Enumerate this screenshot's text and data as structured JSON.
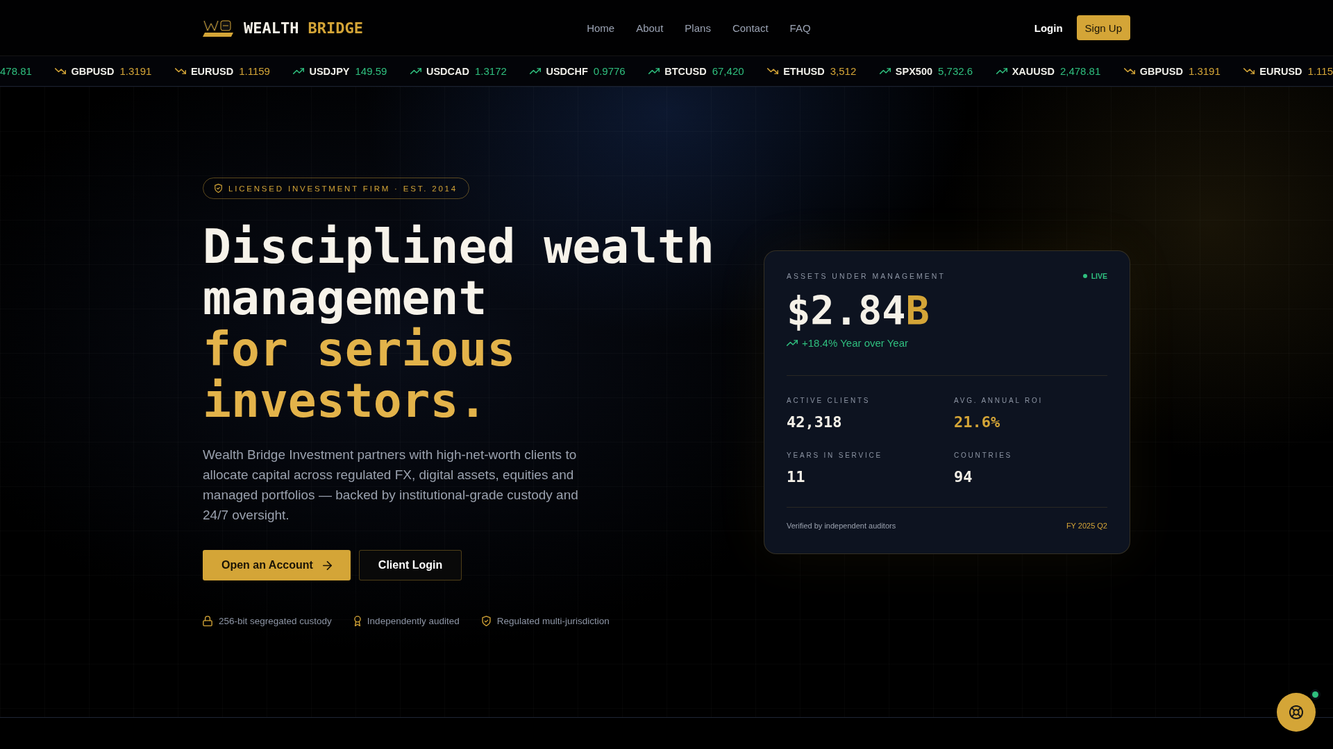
{
  "header": {
    "brand": {
      "name": "WEALTH",
      "accent": "BRIDGE"
    },
    "nav": [
      "Home",
      "About",
      "Plans",
      "Contact",
      "FAQ"
    ],
    "login": "Login",
    "signup": "Sign Up"
  },
  "ticker": [
    {
      "value": "478.81",
      "rising": true
    },
    {
      "symbol": "GBPUSD",
      "value": "1.3191",
      "rising": false
    },
    {
      "symbol": "EURUSD",
      "value": "1.1159",
      "rising": false
    },
    {
      "symbol": "USDJPY",
      "value": "149.59",
      "rising": true
    },
    {
      "symbol": "USDCAD",
      "value": "1.3172",
      "rising": true
    },
    {
      "symbol": "USDCHF",
      "value": "0.9776",
      "rising": true
    },
    {
      "symbol": "BTCUSD",
      "value": "67,420",
      "rising": true
    },
    {
      "symbol": "ETHUSD",
      "value": "3,512",
      "rising": false
    },
    {
      "symbol": "SPX500",
      "value": "5,732.6",
      "rising": true
    },
    {
      "symbol": "XAUUSD",
      "value": "2,478.81",
      "rising": true
    },
    {
      "symbol": "GBPUSD",
      "value": "1.3191",
      "rising": false
    },
    {
      "symbol": "EURUSD",
      "value": "1.115",
      "rising": false
    }
  ],
  "hero": {
    "badge": "LICENSED INVESTMENT FIRM · EST. 2014",
    "headline": "Disciplined wealth management",
    "headline_accent": "for serious investors.",
    "description": "Wealth Bridge Investment partners with high-net-worth clients to allocate capital across regulated FX, digital assets, equities and managed portfolios — backed by institutional-grade custody and 24/7 oversight.",
    "actions": [
      {
        "label": "Open an Account",
        "kind": "primary"
      },
      {
        "label": "Client Login",
        "kind": "secondary"
      }
    ],
    "trust": [
      "256-bit segregated custody",
      "Independently audited",
      "Regulated multi-jurisdiction"
    ]
  },
  "card": {
    "title": "ASSETS UNDER MANAGEMENT",
    "status": {
      "label": "LIVE",
      "live": true
    },
    "value": "$2.84",
    "unit": "B",
    "change": {
      "text": "+18.4% Year over Year",
      "rising": true
    },
    "stats": [
      {
        "label": "ACTIVE CLIENTS",
        "value": "42,318",
        "highlight": false
      },
      {
        "label": "AVG. ANNUAL ROI",
        "value": "21.6%",
        "highlight": true
      },
      {
        "label": "YEARS IN SERVICE",
        "value": "11",
        "highlight": false
      },
      {
        "label": "COUNTRIES",
        "value": "94",
        "highlight": false
      }
    ],
    "footnote": "Verified by independent auditors",
    "period": "FY 2025 Q2"
  },
  "help_button": {
    "online": true
  }
}
